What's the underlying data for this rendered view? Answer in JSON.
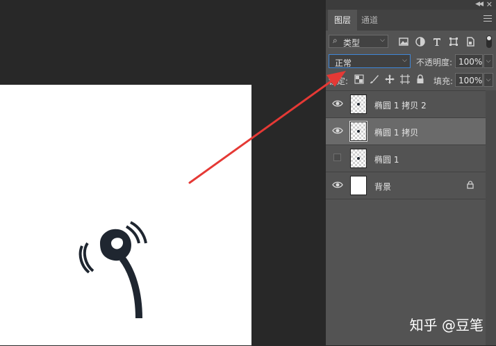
{
  "panel": {
    "tabs": [
      {
        "label": "图层"
      },
      {
        "label": "通道"
      }
    ],
    "filter": {
      "label": "类型"
    },
    "blend_mode": "正常",
    "opacity_label": "不透明度:",
    "opacity_value": "100%",
    "lock_label": "锁定:",
    "fill_label": "填充:",
    "fill_value": "100%"
  },
  "layers": [
    {
      "name": "椭圆 1 拷贝 2",
      "visible": true,
      "selected": false
    },
    {
      "name": "椭圆 1 拷贝",
      "visible": true,
      "selected": true
    },
    {
      "name": "椭圆 1",
      "visible": false,
      "selected": false
    },
    {
      "name": "背景",
      "visible": true,
      "selected": false,
      "locked": true
    }
  ],
  "watermark": "知乎 @豆笔",
  "colors": {
    "workspace": "#282828",
    "panel": "#535353",
    "selected_row": "#6a6a6a",
    "annotation_arrow": "#e53935",
    "artwork": "#1f2630",
    "blend_focus": "#3f87d8"
  },
  "icons": {
    "filter": [
      "image-filter-icon",
      "adjustment-filter-icon",
      "type-filter-icon",
      "shape-filter-icon",
      "smart-object-filter-icon"
    ],
    "lock": [
      "lock-transparent-pixels-icon",
      "lock-image-pixels-icon",
      "lock-position-icon",
      "lock-artboard-icon",
      "lock-all-icon"
    ]
  }
}
